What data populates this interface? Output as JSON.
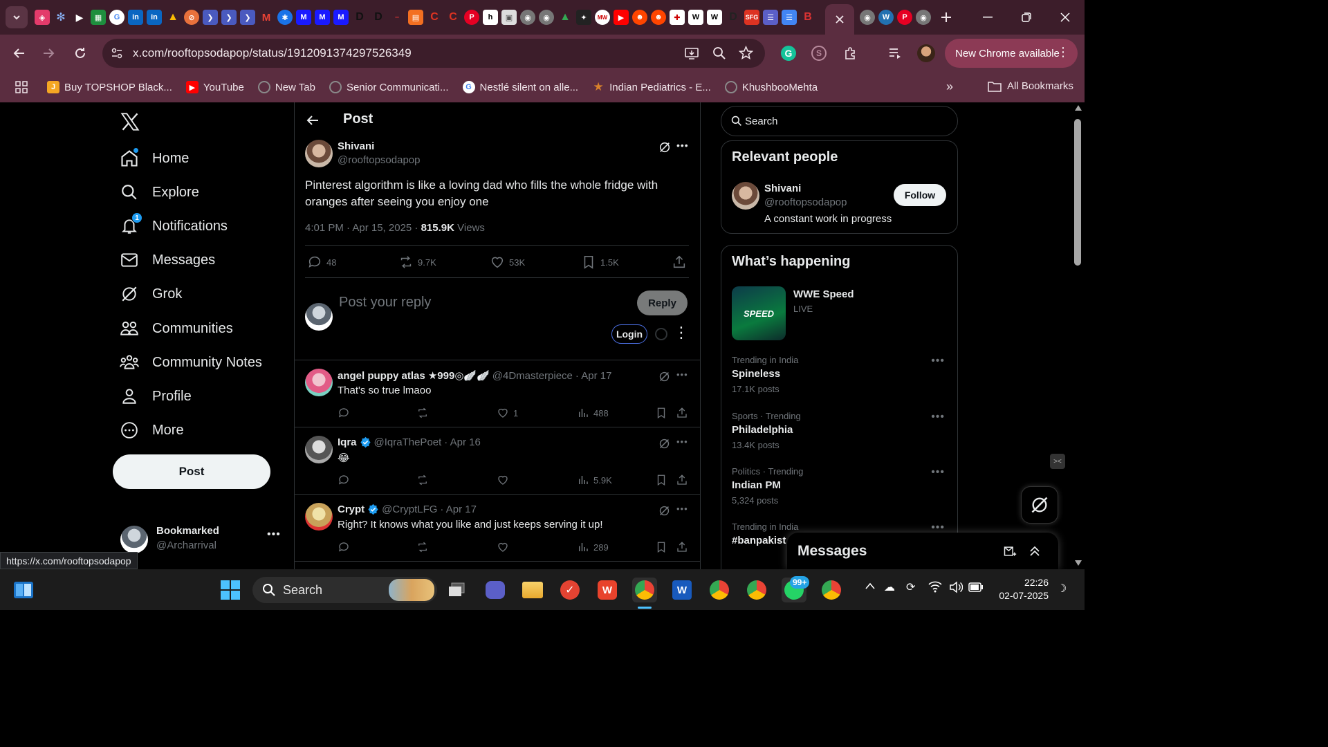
{
  "browser": {
    "url": "x.com/rooftopsodapop/status/1912091374297526349",
    "new_chrome_label": "New Chrome available",
    "bookmarks": [
      {
        "label": "Buy TOPSHOP Black...",
        "icon": "J",
        "color": "#f5a623"
      },
      {
        "label": "YouTube",
        "icon": "▶",
        "color": "#ff0000"
      },
      {
        "label": "New Tab",
        "icon": "",
        "color": "#8a8a8a"
      },
      {
        "label": "Senior Communicati...",
        "icon": "",
        "color": "#8a8a8a"
      },
      {
        "label": "Nestlé silent on alle...",
        "icon": "G",
        "color": "#ffffff"
      },
      {
        "label": "Indian Pediatrics - E...",
        "icon": "★",
        "color": "#d9822b"
      },
      {
        "label": "KhushbooMehta",
        "icon": "",
        "color": "#8a8a8a"
      }
    ],
    "all_bookmarks_label": "All Bookmarks",
    "status_url": "https://x.com/rooftopsodapop"
  },
  "nav": {
    "items": [
      {
        "label": "Home",
        "icon": "home-icon"
      },
      {
        "label": "Explore",
        "icon": "search-icon"
      },
      {
        "label": "Notifications",
        "icon": "bell-icon",
        "badge": "1"
      },
      {
        "label": "Messages",
        "icon": "envelope-icon"
      },
      {
        "label": "Grok",
        "icon": "grok-icon"
      },
      {
        "label": "Communities",
        "icon": "communities-icon"
      },
      {
        "label": "Community Notes",
        "icon": "notes-icon"
      },
      {
        "label": "Profile",
        "icon": "person-icon"
      },
      {
        "label": "More",
        "icon": "more-circle-icon"
      }
    ],
    "post_label": "Post",
    "account": {
      "name": "Bookmarked",
      "handle": "@Archarrival"
    }
  },
  "main": {
    "header_title": "Post",
    "post": {
      "author": "Shivani",
      "handle": "@rooftopsodapop",
      "text_line1": "Pinterest algorithm is like a loving dad who fills the whole fridge with",
      "text_line2": "oranges after seeing you enjoy one",
      "meta_time": "4:01 PM · Apr 15, 2025 · ",
      "views_count": "815.9K",
      "views_label": " Views",
      "replies": "48",
      "reposts": "9.7K",
      "likes": "53K",
      "bookmarks": "1.5K"
    },
    "composer": {
      "placeholder": "Post your reply",
      "reply_label": "Reply",
      "login_label": "Login"
    },
    "replies": [
      {
        "name": "angel puppy atlas ★999◎🪽🪽",
        "handle": "@4Dmasterpiece",
        "date": "· Apr 17",
        "text": "That's so true lmaoo",
        "likes": "1",
        "views": "488",
        "verified": false
      },
      {
        "name": "Iqra",
        "handle": "@IqraThePoet",
        "date": "· Apr 16",
        "text": "😂",
        "likes": "",
        "views": "5.9K",
        "verified": true
      },
      {
        "name": "Crypt",
        "handle": "@CryptLFG",
        "date": "· Apr 17",
        "text": "Right? It knows what you like and just keeps serving it up!",
        "likes": "",
        "views": "289",
        "verified": true
      }
    ]
  },
  "right": {
    "search_placeholder": "Search",
    "relevant": {
      "title": "Relevant people",
      "name": "Shivani",
      "handle": "@rooftopsodapop",
      "bio": "A constant work in progress",
      "follow_label": "Follow"
    },
    "happening": {
      "title": "What’s happening",
      "event": {
        "title": "WWE Speed",
        "status": "LIVE",
        "thumb_text": "SPEED"
      },
      "trends": [
        {
          "context": "Trending in India",
          "topic": "Spineless",
          "posts": "17.1K posts"
        },
        {
          "context": "Sports · Trending",
          "topic": "Philadelphia",
          "posts": "13.4K posts"
        },
        {
          "context": "Politics · Trending",
          "topic": "Indian PM",
          "posts": "5,324 posts"
        },
        {
          "context": "Trending in India",
          "topic": "#banpakist",
          "posts": ""
        }
      ]
    },
    "messages_label": "Messages"
  },
  "taskbar": {
    "search_label": "Search",
    "time": "22:26",
    "date": "02-07-2025",
    "whatsapp_badge": "99+"
  },
  "colors": {
    "accent": "#1d9bf0",
    "chrome_frame": "#3c1d2a",
    "chrome_toolbar": "#5b2d40"
  }
}
